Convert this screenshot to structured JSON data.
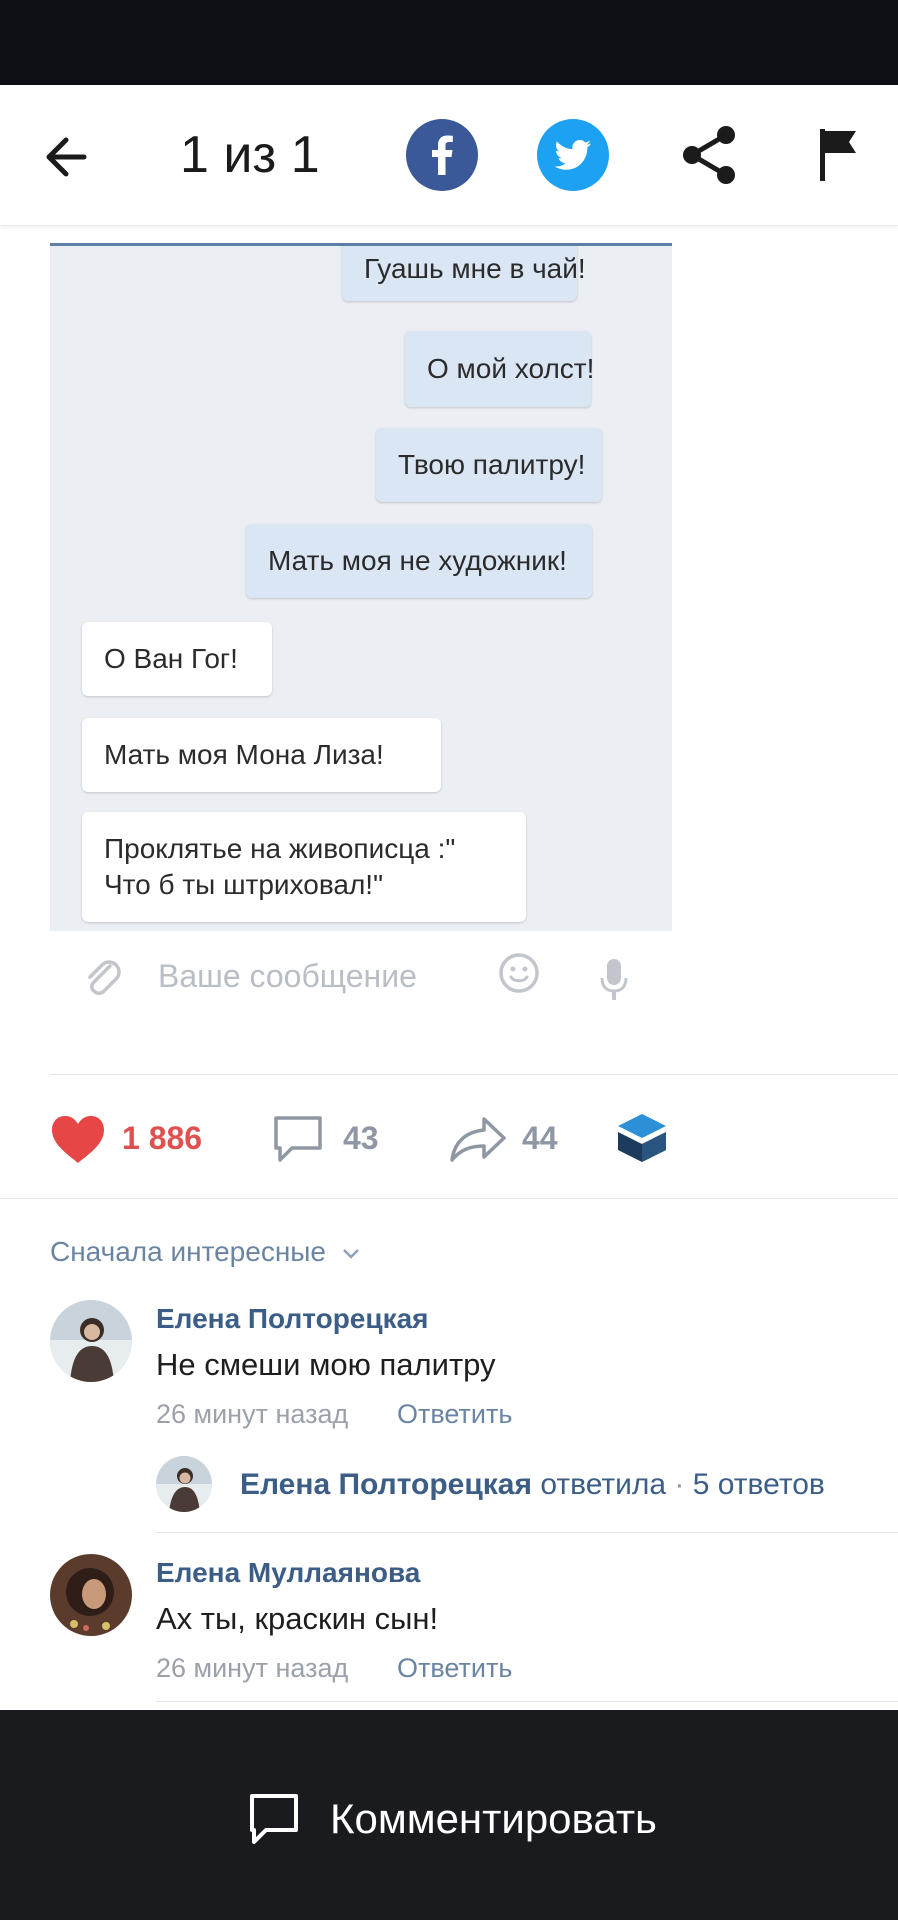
{
  "header": {
    "counter": "1 из 1"
  },
  "chat": {
    "messages": [
      {
        "side": "out",
        "text": "Гуашь мне в чай!"
      },
      {
        "side": "out",
        "text": "О мой холст!"
      },
      {
        "side": "out",
        "text": "Твою палитру!"
      },
      {
        "side": "out",
        "text": "Мать моя не художник!"
      },
      {
        "side": "in",
        "text": "О Ван Гог!"
      },
      {
        "side": "in",
        "text": "Мать моя Мона Лиза!"
      },
      {
        "side": "in",
        "text": "Проклятье на живописца :\"\nЧто б ты штриховал!\""
      }
    ],
    "input_placeholder": "Ваше сообщение"
  },
  "post_actions": {
    "likes": "1 886",
    "comments": "43",
    "shares": "44"
  },
  "comments": {
    "sort_label": "Сначала интересные",
    "items": [
      {
        "author": "Елена Полторецкая",
        "text": "Не смеши мою палитру",
        "time": "26 минут назад",
        "reply_label": "Ответить",
        "thread": {
          "author": "Елена Полторецкая",
          "verb": "ответила",
          "separator": "·",
          "count": "5 ответов"
        }
      },
      {
        "author": "Елена Муллаянова",
        "text": "Ах ты, краскин сын!",
        "time": "26 минут назад",
        "reply_label": "Ответить"
      }
    ]
  },
  "bottom_bar": {
    "comment_button": "Комментировать"
  },
  "colors": {
    "facebook": "#3b5998",
    "twitter": "#1da1f2",
    "like": "#e64646",
    "link_blue": "#3b5d86"
  }
}
